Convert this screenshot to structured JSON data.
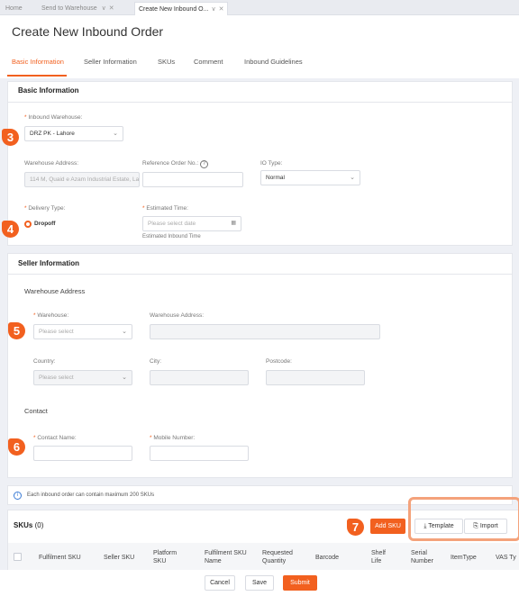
{
  "tabs": [
    {
      "label": "Home"
    },
    {
      "label": "Send to Warehouse"
    },
    {
      "label": "Create New Inbound O..."
    }
  ],
  "page_title": "Create New Inbound Order",
  "nav_tabs": [
    "Basic Information",
    "Seller Information",
    "SKUs",
    "Comment",
    "Inbound Guidelines"
  ],
  "basic": {
    "title": "Basic Information",
    "inbound_warehouse_label": "Inbound Warehouse:",
    "inbound_warehouse_value": "DRZ PK - Lahore",
    "warehouse_address_label": "Warehouse Address:",
    "warehouse_address_value": "114 M, Quaid e Azam Industrial Estate, La",
    "reference_label": "Reference Order No.:",
    "reference_help": "?",
    "io_type_label": "IO Type:",
    "io_type_value": "Normal",
    "delivery_type_label": "Delivery Type:",
    "delivery_type_value": "Dropoff",
    "estimated_time_label": "Estimated Time:",
    "estimated_time_placeholder": "Please select date",
    "estimated_time_hint": "Estimated Inbound Time"
  },
  "seller": {
    "title": "Seller Information",
    "warehouse_address_section": "Warehouse Address",
    "warehouse_label": "Warehouse:",
    "warehouse_placeholder": "Please select",
    "address_label": "Warehouse Address:",
    "country_label": "Country:",
    "country_placeholder": "Please select",
    "city_label": "City:",
    "postcode_label": "Postcode:",
    "contact_section": "Contact",
    "contact_name_label": "Contact Name:",
    "mobile_label": "Mobile Number:"
  },
  "info_text": "Each inbound order can contain maximum 200 SKUs",
  "skus": {
    "title": "SKUs",
    "count": "(0)",
    "add_label": "Add SKU",
    "template_label": "Template",
    "import_label": "Import",
    "columns": [
      "Fulfilment SKU",
      "Seller SKU",
      "Platform SKU",
      "Fulfilment SKU Name",
      "Requested Quantity",
      "Barcode",
      "Shelf Life",
      "Serial Number",
      "ItemType",
      "VAS Ty"
    ]
  },
  "footer": {
    "cancel": "Cancel",
    "save": "Save",
    "submit": "Submit"
  },
  "badges": [
    "3",
    "4",
    "5",
    "6",
    "7"
  ],
  "colors": {
    "accent": "#f2601f",
    "highlight_border": "#f4a27b"
  },
  "icons": {
    "info": "info-icon",
    "download": "download-icon",
    "import": "import-icon",
    "calendar": "calendar-icon",
    "help": "help-icon",
    "chevron": "chevron-down-icon",
    "close": "close-icon"
  }
}
